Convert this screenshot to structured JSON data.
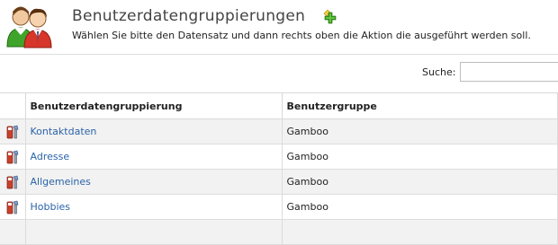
{
  "header": {
    "title": "Benutzerdatengruppierungen",
    "subtitle": "Wählen Sie bitte den Datensatz und dann rechts oben die Aktion die ausgeführt werden soll.",
    "app_icon": "user-group-icon",
    "add_icon": "add-icon"
  },
  "search": {
    "label": "Suche:",
    "value": "",
    "placeholder": ""
  },
  "table": {
    "columns": [
      "Benutzerdatengruppierung",
      "Benutzergruppe"
    ],
    "rows": [
      {
        "name": "Kontaktdaten",
        "group": "Gamboo"
      },
      {
        "name": "Adresse",
        "group": "Gamboo"
      },
      {
        "name": "Allgemeines",
        "group": "Gamboo"
      },
      {
        "name": "Hobbies",
        "group": "Gamboo"
      }
    ],
    "row_icon": "edit-tools-icon"
  },
  "colors": {
    "link": "#2a63a8",
    "row_alt": "#f2f2f2",
    "add_green": "#3a9a1f"
  }
}
